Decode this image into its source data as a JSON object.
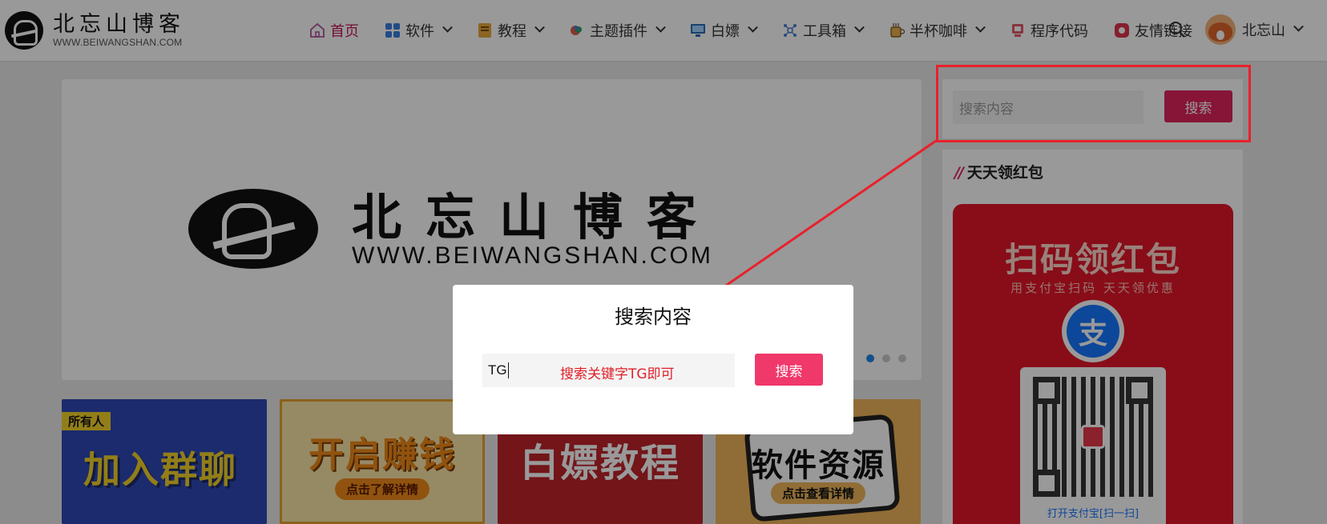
{
  "site": {
    "title": "北忘山博客",
    "url": "WWW.BEIWANGSHAN.COM"
  },
  "nav": [
    {
      "label": "首页",
      "icon": "home-icon",
      "active": true,
      "dropdown": false
    },
    {
      "label": "软件",
      "icon": "grid-icon",
      "active": false,
      "dropdown": true
    },
    {
      "label": "教程",
      "icon": "book-icon",
      "active": false,
      "dropdown": true
    },
    {
      "label": "主题插件",
      "icon": "plugin-icon",
      "active": false,
      "dropdown": true
    },
    {
      "label": "白嫖",
      "icon": "monitor-icon",
      "active": false,
      "dropdown": true
    },
    {
      "label": "工具箱",
      "icon": "toolbox-icon",
      "active": false,
      "dropdown": true
    },
    {
      "label": "半杯咖啡",
      "icon": "coffee-icon",
      "active": false,
      "dropdown": true
    },
    {
      "label": "程序代码",
      "icon": "code-icon",
      "active": false,
      "dropdown": false
    },
    {
      "label": "友情链接",
      "icon": "link-icon",
      "active": false,
      "dropdown": false
    }
  ],
  "user": {
    "name": "北忘山"
  },
  "banner": {
    "title": "北忘山博客",
    "subtitle": "WWW.BEIWANGSHAN.COM",
    "slides": 3,
    "active_slide": 1
  },
  "cards": [
    {
      "tag": "所有人",
      "text": "加入群聊"
    },
    {
      "text": "开启赚钱",
      "pill": "点击了解详情"
    },
    {
      "text": "白嫖教程"
    },
    {
      "text": "软件资源",
      "pill": "点击查看详情"
    }
  ],
  "sidebar": {
    "search_placeholder": "搜索内容",
    "search_button": "搜索",
    "widget_title": "天天领红包",
    "redpack": {
      "title": "扫码领红包",
      "subtitle": "用支付宝扫码 天天领优惠",
      "logo_char": "支",
      "footer": "打开支付宝[扫一扫]"
    }
  },
  "modal": {
    "title": "搜索内容",
    "input_value": "TG",
    "hint": "搜索关键字TG即可",
    "button": "搜索"
  },
  "colors": {
    "accent": "#e0245e",
    "annotation": "#e8212b",
    "alipay": "#1677ff"
  }
}
